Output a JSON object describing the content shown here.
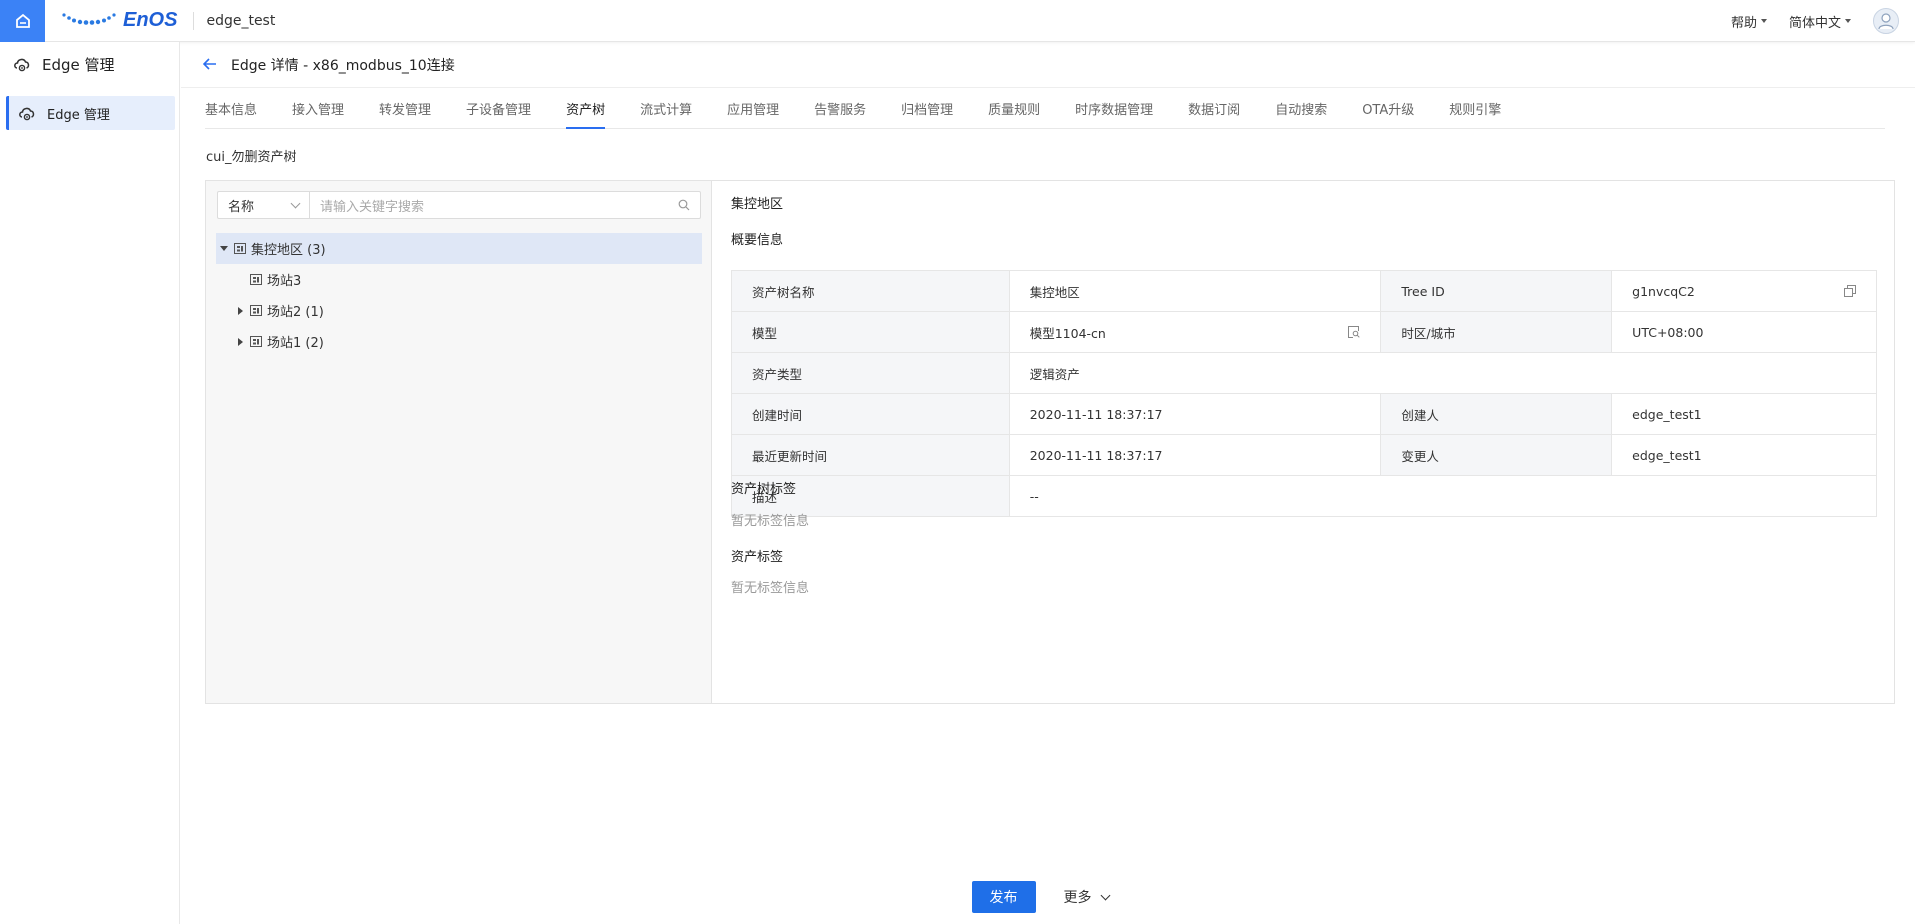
{
  "header": {
    "logo_text": "EnOS",
    "app_name": "edge_test",
    "help_label": "帮助",
    "language_label": "简体中文"
  },
  "sidebar": {
    "title": "Edge 管理",
    "items": [
      {
        "label": "Edge 管理",
        "active": true
      }
    ]
  },
  "page": {
    "title": "Edge 详情 - x86_modbus_10连接"
  },
  "tabs": [
    {
      "label": "基本信息"
    },
    {
      "label": "接入管理"
    },
    {
      "label": "转发管理"
    },
    {
      "label": "子设备管理"
    },
    {
      "label": "资产树",
      "active": true
    },
    {
      "label": "流式计算"
    },
    {
      "label": "应用管理"
    },
    {
      "label": "告警服务"
    },
    {
      "label": "归档管理"
    },
    {
      "label": "质量规则"
    },
    {
      "label": "时序数据管理"
    },
    {
      "label": "数据订阅"
    },
    {
      "label": "自动搜索"
    },
    {
      "label": "OTA升级"
    },
    {
      "label": "规则引擎"
    }
  ],
  "asset_tree": {
    "name": "cui_勿删资产树",
    "search": {
      "field_selected": "名称",
      "placeholder": "请输入关键字搜索"
    },
    "nodes": [
      {
        "label": "集控地区 (3)",
        "expanded": true,
        "selected": true,
        "level": 0
      },
      {
        "label": "场站3",
        "level": 1,
        "has_children": false
      },
      {
        "label": "场站2 (1)",
        "level": 1,
        "has_children": true
      },
      {
        "label": "场站1 (2)",
        "level": 1,
        "has_children": true
      }
    ]
  },
  "detail": {
    "node_title": "集控地区",
    "overview_title": "概要信息",
    "rows": {
      "tree_name_label": "资产树名称",
      "tree_name_value": "集控地区",
      "tree_id_label": "Tree ID",
      "tree_id_value": "g1nvcqC2",
      "model_label": "模型",
      "model_value": "模型1104-cn",
      "timezone_label": "时区/城市",
      "timezone_value": "UTC+08:00",
      "asset_type_label": "资产类型",
      "asset_type_value": "逻辑资产",
      "created_time_label": "创建时间",
      "created_time_value": "2020-11-11 18:37:17",
      "creator_label": "创建人",
      "creator_value": "edge_test1",
      "updated_time_label": "最近更新时间",
      "updated_time_value": "2020-11-11 18:37:17",
      "modifier_label": "变更人",
      "modifier_value": "edge_test1",
      "desc_label": "描述",
      "desc_value": "--"
    },
    "tree_tags_title": "资产树标签",
    "tree_tags_empty": "暂无标签信息",
    "asset_tags_title": "资产标签",
    "asset_tags_empty": "暂无标签信息"
  },
  "footer": {
    "publish_label": "发布",
    "more_label": "更多"
  },
  "colors": {
    "accent": "#2a6ef0",
    "primary_button": "#1f6fe8",
    "selected_row": "#dfe7f6"
  }
}
